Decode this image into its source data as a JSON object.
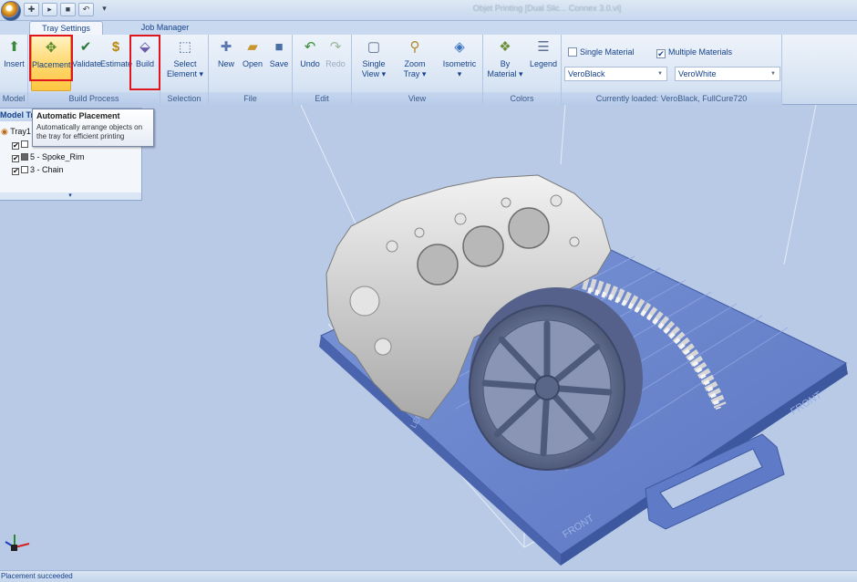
{
  "window": {
    "title": "Objet Printing [Dual Slic... Connex 3.0.vi]"
  },
  "qat": {
    "icons": [
      "new-tray",
      "open",
      "save",
      "undo"
    ],
    "more": "▾"
  },
  "tabs": [
    {
      "label": "Tray Settings",
      "active": true
    },
    {
      "label": "Job Manager",
      "active": false
    }
  ],
  "ribbon": {
    "groups": {
      "model": "Model",
      "build_process": "Build Process",
      "selection": "Selection",
      "file": "File",
      "edit": "Edit",
      "view": "View",
      "colors": "Colors",
      "materials": "Currently loaded: VeroBlack, FullCure720"
    },
    "buttons": {
      "insert": "Insert",
      "placement": "Placement",
      "validate": "Validate",
      "estimate": "Estimate",
      "build": "Build",
      "select_element_1": "Select",
      "select_element_2": "Element ▾",
      "new": "New",
      "open": "Open",
      "save": "Save",
      "undo": "Undo",
      "redo": "Redo",
      "single_view_1": "Single",
      "single_view_2": "View ▾",
      "zoom_tray_1": "Zoom",
      "zoom_tray_2": "Tray ▾",
      "isometric_1": "Isometric",
      "isometric_2": "▾",
      "by_material_1": "By",
      "by_material_2": "Material ▾",
      "legend": "Legend"
    },
    "materials": {
      "single_label": "Single Material",
      "single_checked": false,
      "multiple_label": "Multiple Materials",
      "multiple_checked": true,
      "material1": "VeroBlack",
      "material2": "VeroWhite"
    }
  },
  "tooltip": {
    "title": "Automatic Placement",
    "body": "Automatically arrange objects on the tray for efficient printing"
  },
  "tree": {
    "header": "Model Tree",
    "root": "Tray1",
    "items": [
      {
        "label": "",
        "checked": true
      },
      {
        "label": "5 - Spoke_Rim",
        "checked": true
      },
      {
        "label": "3 - Chain",
        "checked": true
      }
    ],
    "collapse": "▾"
  },
  "tray": {
    "labels": [
      "FRONT",
      "FRONT",
      "LEFT"
    ]
  },
  "status": {
    "text": "Placement succeeded"
  }
}
